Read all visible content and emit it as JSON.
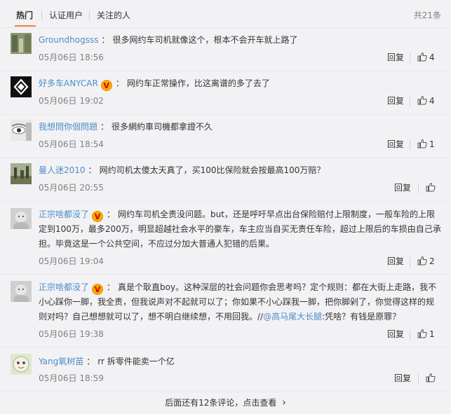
{
  "tabs": [
    {
      "label": "热门"
    },
    {
      "label": "认证用户"
    },
    {
      "label": "关注的人"
    }
  ],
  "total_count": "共21条",
  "reply_label": "回复",
  "comments": [
    {
      "user": "Groundhogsss",
      "separator": "：",
      "text": "很多网约车司机就像这个，根本不会开车就上路了",
      "time": "05月06日 18:56",
      "likes": "4"
    },
    {
      "user": "好多车ANYCAR",
      "separator": "：",
      "text": "网约车正常操作，比这离谱的多了去了",
      "time": "05月06日 19:02",
      "likes": "4"
    },
    {
      "user": "我想問你個問題",
      "separator": "：",
      "text": "很多網約車司機都拿證不久",
      "time": "05月06日 18:54",
      "likes": "1"
    },
    {
      "user": "曼人迷2010",
      "separator": "：",
      "text": "网约司机太傻太天真了，买100比保险就会按最高100万赔？",
      "time": "05月06日 20:55",
      "likes": ""
    },
    {
      "user": "正宗啥都没了",
      "separator": "：",
      "text": "网约车司机全责没问题。but，还是呼吁早点出台保险赔付上限制度，一般车险的上限定到100万，最多200万，明显超越社会水平的豪车，车主应当自买无责任车险，超过上限后的车损由自己承担。毕竟这是一个公共空间，不应过分加大普通人犯错的后果。",
      "time": "05月06日 19:04",
      "likes": "2"
    },
    {
      "user": "正宗啥都没了",
      "separator": "：",
      "text_before": "真是个耿直boy。这种深层的社会问题你会思考吗？定个规则：都在大街上走路，我不小心踩你一脚，我全责，但我说声对不起就可以了；你如果不小心踩我一脚，把你脚剁了，你觉得这样的规则对吗？自己想想就可以了，想不明白继续想，不用回我。//",
      "mention": "@高马尾大长腿",
      "text_after": ":凭啥？有钱是原罪？",
      "time": "05月06日 19:38",
      "likes": "1"
    },
    {
      "user": "Yang氧树苗",
      "separator": "：",
      "text": "rr 拆零件能卖一个亿",
      "time": "05月06日 18:59",
      "likes": ""
    }
  ],
  "verified_badge": "V",
  "more_link": "后面还有12条评论，点击查看",
  "more_chevron": "›",
  "icons": {
    "like": "thumbs-up-icon",
    "verified": "verified-badge-icon",
    "more": "chevron-right-icon"
  },
  "colors": {
    "accent": "#fa7d3c",
    "username": "#eb7350",
    "link": "#4e8dc6",
    "muted": "#808080"
  }
}
